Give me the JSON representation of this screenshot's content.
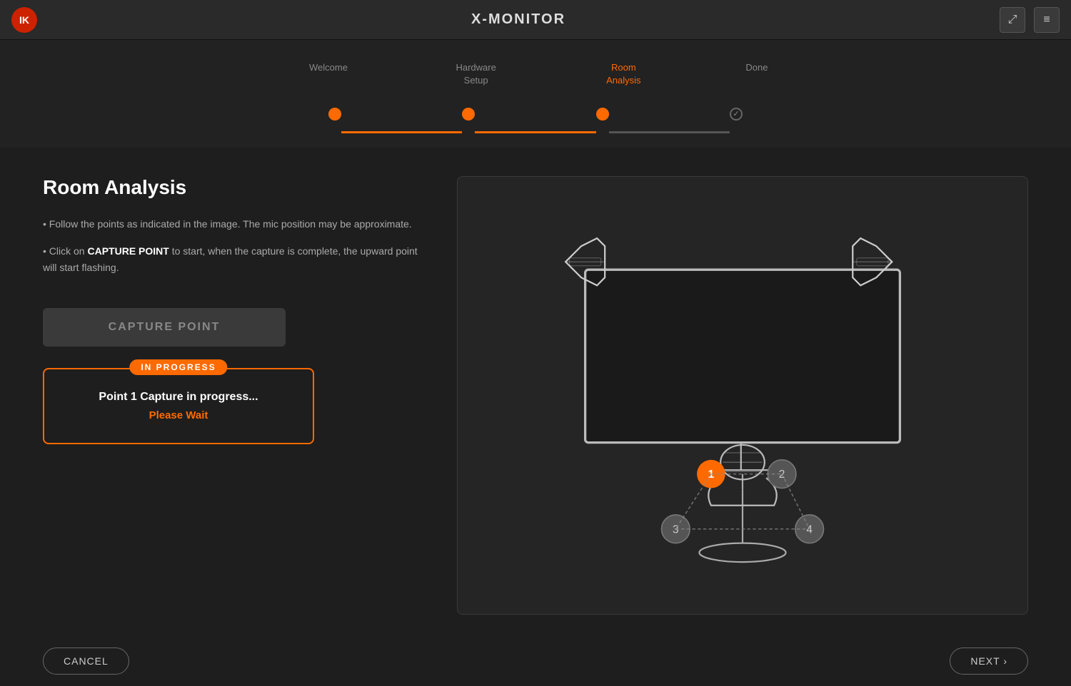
{
  "header": {
    "title": "X-MONITOR",
    "logo_text": "IK"
  },
  "stepper": {
    "steps": [
      {
        "label": "Welcome",
        "state": "done"
      },
      {
        "label": "Hardware\nSetup",
        "state": "done"
      },
      {
        "label": "Room\nAnalysis",
        "state": "active"
      },
      {
        "label": "Done",
        "state": "inactive"
      }
    ]
  },
  "main": {
    "section_title": "Room Analysis",
    "instructions": [
      "• Follow the points as indicated in the image. The mic position may be approximate.",
      "• Click on CAPTURE POINT to start, when the capture is complete, the upward point will start flashing."
    ],
    "capture_button_label": "CAPTURE POINT",
    "progress": {
      "badge": "IN PROGRESS",
      "message": "Point 1 Capture in progress...",
      "wait_text": "Please Wait"
    }
  },
  "footer": {
    "cancel_label": "CANCEL",
    "next_label": "NEXT ›"
  },
  "icons": {
    "expand": "⤢",
    "menu": "≡"
  }
}
